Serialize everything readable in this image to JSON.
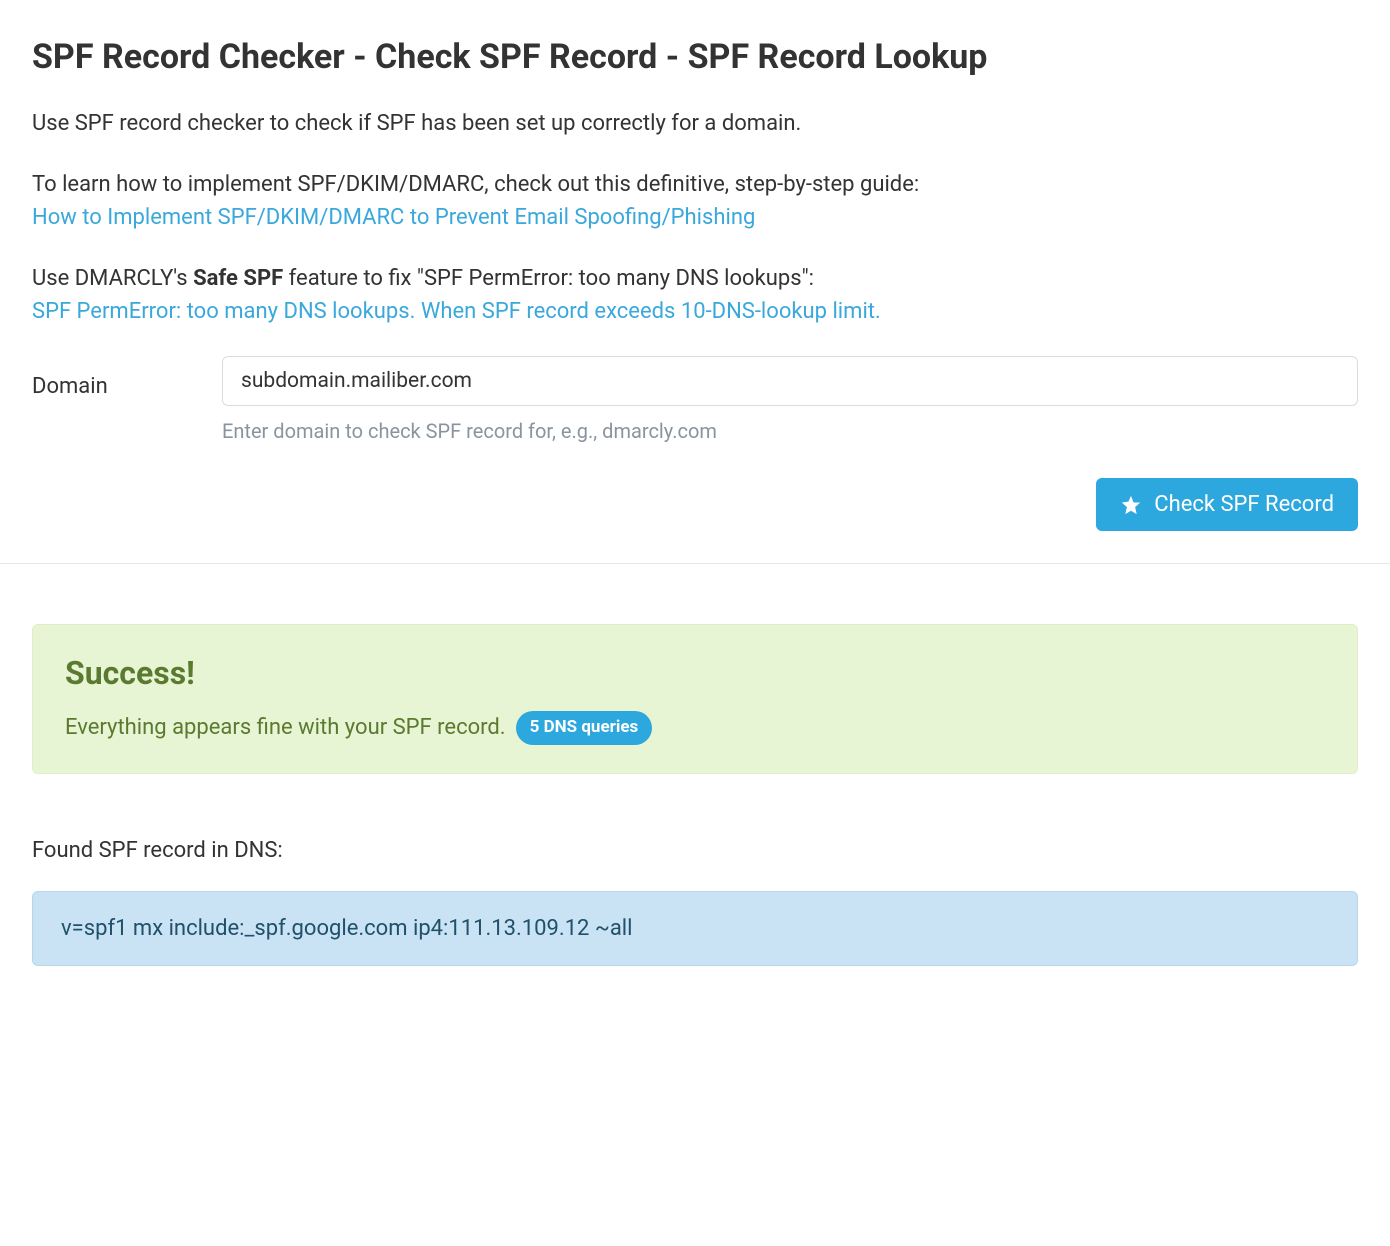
{
  "page": {
    "title": "SPF Record Checker - Check SPF Record - SPF Record Lookup",
    "intro": "Use SPF record checker to check if SPF has been set up correctly for a domain.",
    "guide_intro": "To learn how to implement SPF/DKIM/DMARC, check out this definitive, step-by-step guide:",
    "guide_link": "How to Implement SPF/DKIM/DMARC to Prevent Email Spoofing/Phishing",
    "safespf_pre": "Use DMARCLY's ",
    "safespf_bold": "Safe SPF",
    "safespf_post": " feature to fix \"SPF PermError: too many DNS lookups\":",
    "permerror_link": "SPF PermError: too many DNS lookups. When SPF record exceeds 10-DNS-lookup limit."
  },
  "form": {
    "domain_label": "Domain",
    "domain_value": "subdomain.mailiber.com",
    "domain_help": "Enter domain to check SPF record for, e.g., dmarcly.com",
    "submit_label": "Check SPF Record"
  },
  "result": {
    "success_title": "Success!",
    "success_message": "Everything appears fine with your SPF record.",
    "dns_badge": "5 DNS queries",
    "found_heading": "Found SPF record in DNS:",
    "spf_record": "v=spf1 mx include:_spf.google.com ip4:111.13.109.12 ~all"
  }
}
